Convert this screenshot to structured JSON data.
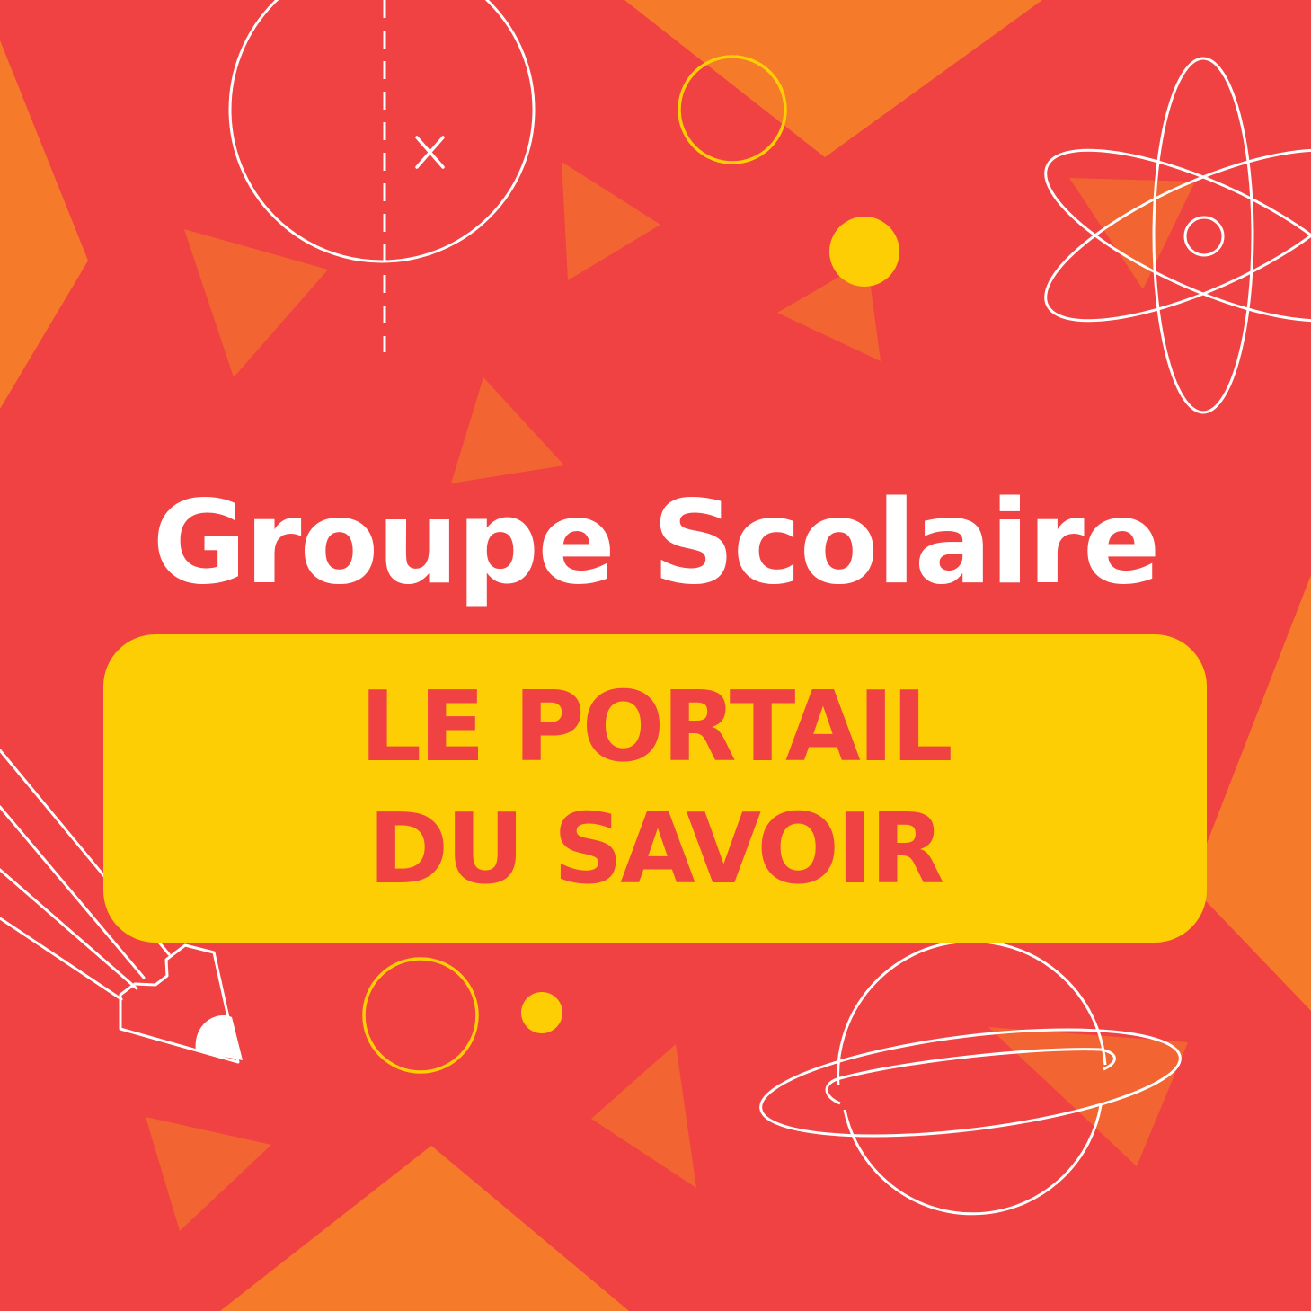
{
  "colors": {
    "background": "#f04242",
    "orange": "#f57b2b",
    "orange_triangle": "#f26432",
    "yellow": "#fcce03",
    "white": "#ffffff",
    "title": "#ffffff",
    "banner_background": "#fcce03",
    "banner_text": "#f04242"
  },
  "title": "Groupe Scolaire",
  "banner": {
    "line1": "LE PORTAIL",
    "line2": "DU SAVOIR"
  },
  "icons": [
    "circle-outline-icon",
    "dashed-line-icon",
    "x-mark-icon",
    "atom-icon",
    "pencil-icon",
    "planet-icon",
    "triangle-shape",
    "dot-shape"
  ]
}
